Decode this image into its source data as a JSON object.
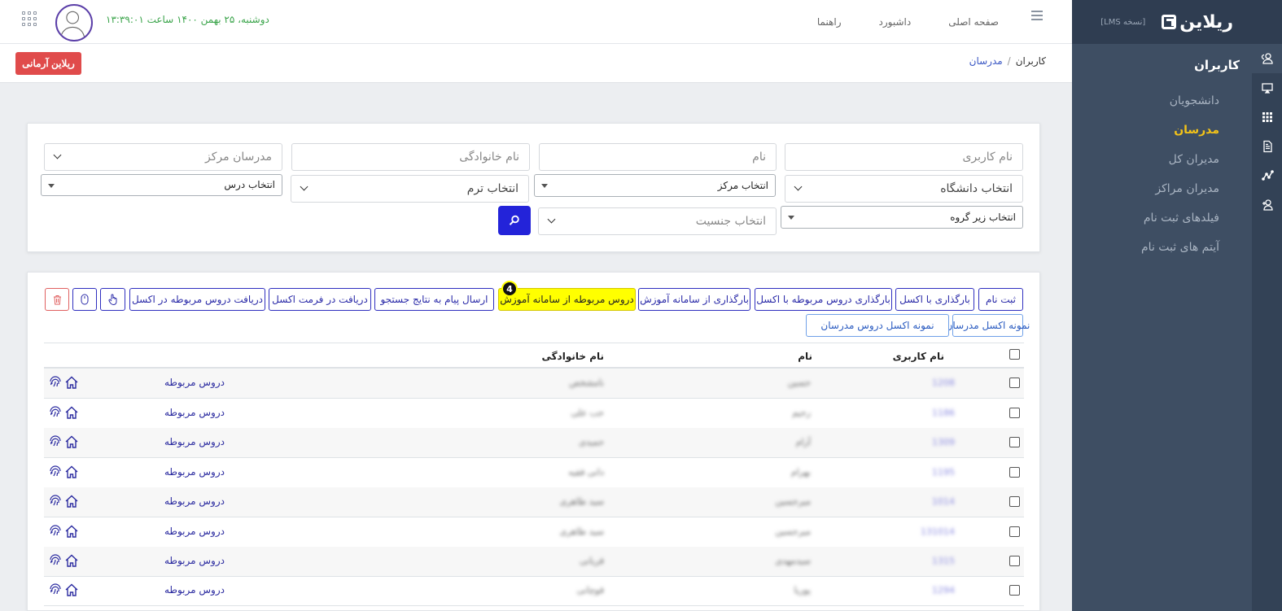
{
  "sidebar": {
    "brand_name": "ریلاین",
    "version": "[نسخه LMS]",
    "section_title": "کاربران",
    "items": [
      {
        "label": "دانشجویان"
      },
      {
        "label": "مدرسان"
      },
      {
        "label": "مدیران کل"
      },
      {
        "label": "مدیران مراکز"
      },
      {
        "label": "فیلدهای ثبت نام"
      },
      {
        "label": "آیتم های ثبت نام"
      }
    ],
    "rail_icons": [
      "users-icon",
      "monitor-icon",
      "grid-icon",
      "document-icon",
      "chart-icon",
      "add-user-icon"
    ]
  },
  "topbar": {
    "nav": [
      "صفحه اصلی",
      "داشبورد",
      "راهنما"
    ],
    "datetime": "دوشنبه، ۲۵ بهمن ۱۴۰۰ ساعت ۱۳:۳۹:۰۱"
  },
  "breadcrumb": {
    "root": "کاربران",
    "separator": "/",
    "current": "مدرسان"
  },
  "header_button": "ریلاین آرمانی",
  "filters": {
    "username": "نام کاربری",
    "first_name": "نام",
    "last_name": "نام خانوادگی",
    "center_teachers": "مدرسان مرکز",
    "university": "انتخاب دانشگاه",
    "center": "انتخاب مرکز",
    "term": "انتخاب ترم",
    "course": "انتخاب درس",
    "subgroup": "انتخاب زیر گروه",
    "gender": "انتخاب جنسیت"
  },
  "toolbar": {
    "register": "ثبت نام",
    "upload_excel": "بارگذاری با اکسل",
    "upload_courses_excel": "بارگذاری دروس مربوطه با اکسل",
    "upload_lms": "بارگذاری از سامانه آموزش",
    "courses_from_lms": "دروس مربوطه از سامانه آموزش",
    "send_message": "ارسال پیام به نتایج جستجو",
    "download_excel": "دریافت در فرمت اکسل",
    "download_courses_excel": "دریافت دروس مربوطه در اکسل",
    "sample_teachers": "نمونه اکسل مدرسان",
    "sample_courses": "نمونه اکسل دروس مدرسان",
    "step_badge": "4"
  },
  "table": {
    "headers": {
      "username": "نام کاربری",
      "first_name": "نام",
      "last_name": "نام خانوادگی"
    },
    "rows": [
      {
        "username": "1208",
        "first_name": "حسین",
        "last_name": "نامشخص",
        "courses": "دروس مربوطه"
      },
      {
        "username": "1186",
        "first_name": "رحیم",
        "last_name": "حب علی",
        "courses": "دروس مربوطه"
      },
      {
        "username": "1309",
        "first_name": "آرام",
        "last_name": "حمیدی",
        "courses": "دروس مربوطه"
      },
      {
        "username": "1195",
        "first_name": "بهرام",
        "last_name": "دانی فقیه",
        "courses": "دروس مربوطه"
      },
      {
        "username": "1014",
        "first_name": "میرحسین",
        "last_name": "سید طاهری",
        "courses": "دروس مربوطه"
      },
      {
        "username": "131014",
        "first_name": "میرحسین",
        "last_name": "سید طاهری",
        "courses": "دروس مربوطه"
      },
      {
        "username": "1315",
        "first_name": "سیدمهدی",
        "last_name": "قربانی",
        "courses": "دروس مربوطه"
      },
      {
        "username": "1294",
        "first_name": "پوریا",
        "last_name": "قوچانی",
        "courses": "دروس مربوطه"
      }
    ]
  },
  "colors": {
    "accent": "#2323d9",
    "sidebar": "#3e4e63",
    "active_menu": "#f3c318",
    "danger": "#e04b4b",
    "highlight": "#ffff00"
  }
}
